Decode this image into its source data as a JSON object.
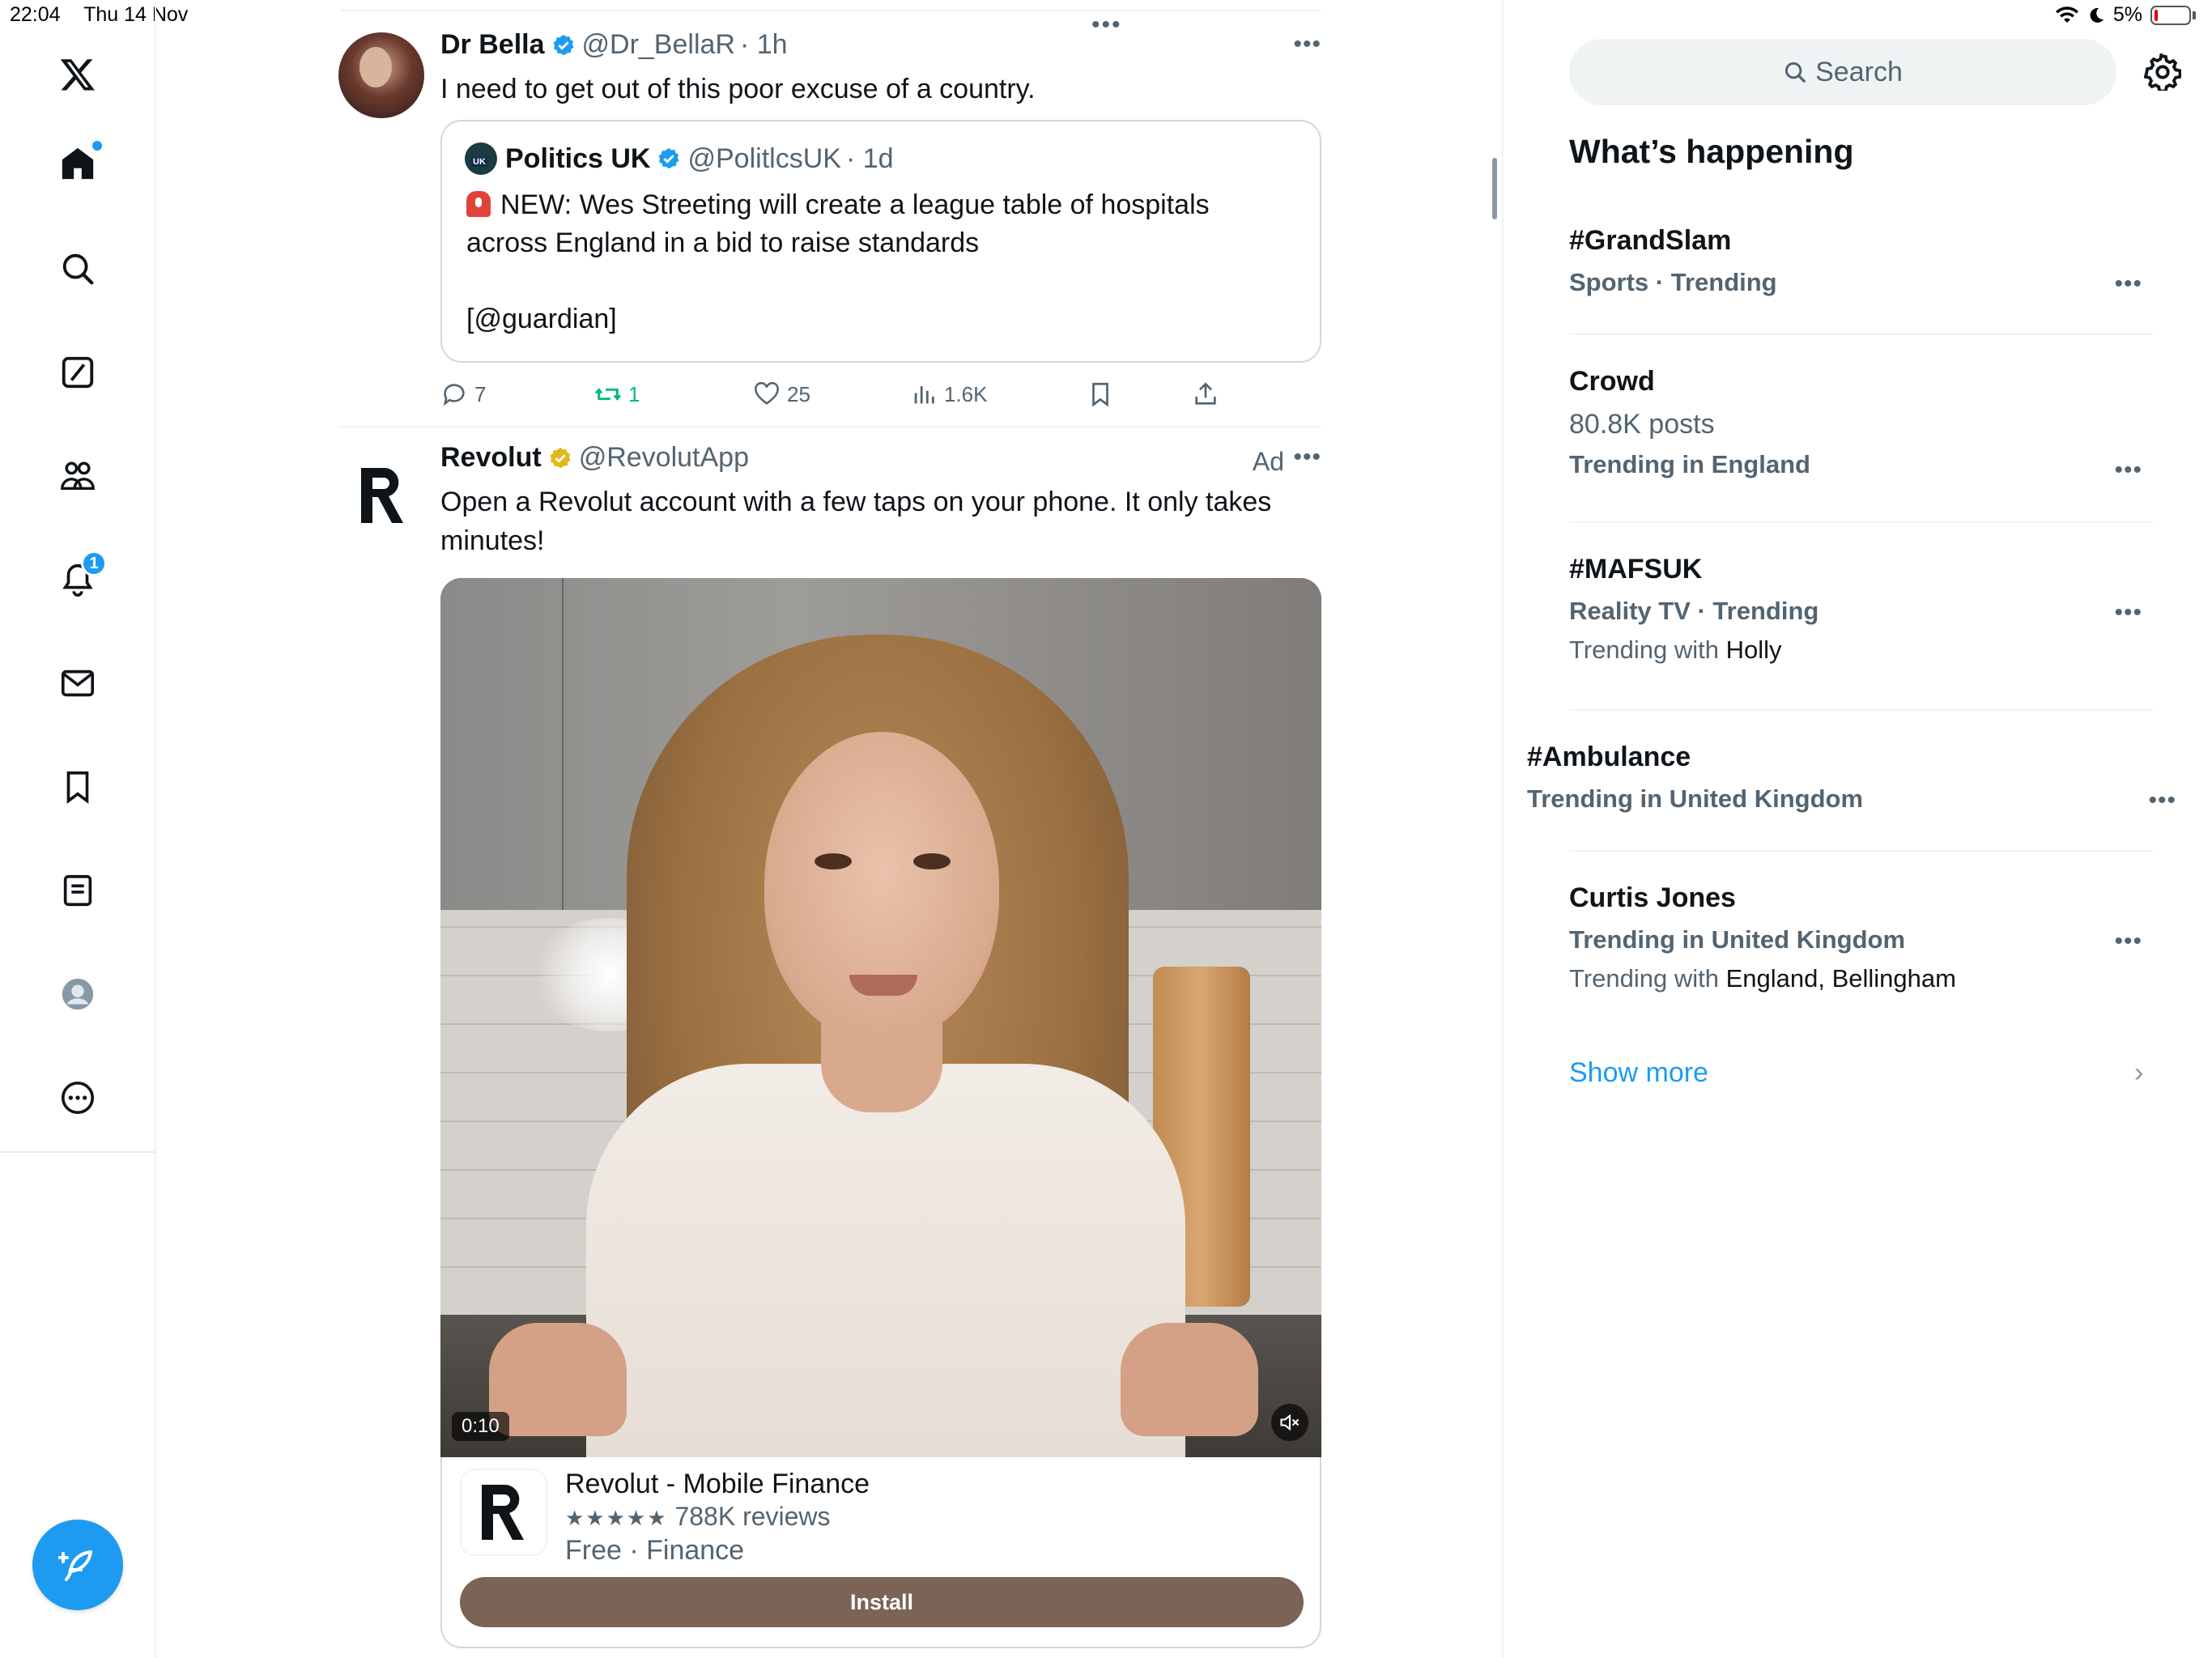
{
  "status": {
    "time": "22:04",
    "date": "Thu 14 Nov",
    "battery": "5%"
  },
  "nav": {
    "notifications_badge": "1",
    "items": [
      "x-logo",
      "home",
      "explore",
      "grok",
      "communities",
      "notifications",
      "messages",
      "bookmarks",
      "lists",
      "profile",
      "more"
    ]
  },
  "tweet1": {
    "name": "Dr Bella",
    "handle": "@Dr_BellaR",
    "time": "· 1h",
    "text": "I need to get out of this poor excuse of a country.",
    "quote": {
      "name": "Politics UK",
      "handle": "@PolitlcsUK",
      "time": "· 1d",
      "text_line1": "NEW: Wes Streeting will create a league table of hospitals",
      "text_line2": "across England in a bid to raise standards",
      "text_line3": "[@guardian]"
    },
    "replies": "7",
    "reposts": "1",
    "likes": "25",
    "views": "1.6K"
  },
  "tweet2": {
    "name": "Revolut",
    "handle": "@RevolutApp",
    "ad_label": "Ad",
    "text_line1": "Open a Revolut account with a few taps on your phone. It only takes",
    "text_line2": "minutes!",
    "video_time": "0:10",
    "card": {
      "title": "Revolut - Mobile Finance",
      "stars": "★★★★★",
      "reviews": "788K reviews",
      "subtitle": "Free · Finance",
      "install_label": "Install"
    }
  },
  "sidebar": {
    "search_placeholder": "Search",
    "heading": "What’s happening",
    "trends": [
      {
        "title": "#GrandSlam",
        "context": "Sports · Trending"
      },
      {
        "title": "Crowd",
        "posts": "80.8K posts",
        "context": "Trending in England"
      },
      {
        "title": "#MAFSUK",
        "context": "Reality TV · Trending",
        "with_label": "Trending with",
        "with": "Holly"
      },
      {
        "title": "#Ambulance",
        "context": "Trending in United Kingdom"
      },
      {
        "title": "Curtis Jones",
        "context": "Trending in United Kingdom",
        "with_label": "Trending with",
        "with": "England, Bellingham"
      }
    ],
    "show_more": "Show more"
  },
  "colors": {
    "accent": "#1d9bf0",
    "repost_green": "#00ba7c",
    "install_button": "#7b6355",
    "gold_verified": "#e2b719"
  }
}
